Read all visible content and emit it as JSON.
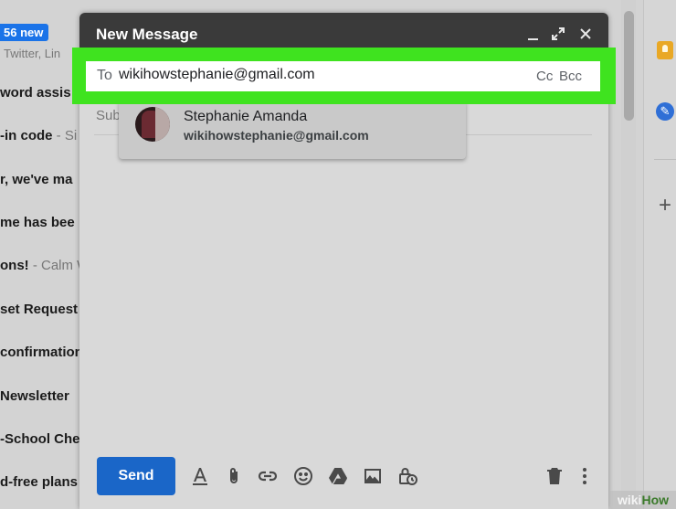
{
  "inbox": {
    "new_badge": "56 new",
    "badge_sub": "Twitter, Lin",
    "rows": [
      {
        "bold": "word assis",
        "snip": ""
      },
      {
        "bold": "-in code",
        "snip": " - Si"
      },
      {
        "bold": "r, we've ma",
        "snip": ""
      },
      {
        "bold": "me has bee",
        "snip": ""
      },
      {
        "bold": "ons!",
        "snip": " - Calm W"
      },
      {
        "bold": "set Request",
        "snip": ""
      },
      {
        "bold": "confirmation",
        "snip": ""
      },
      {
        "bold": " Newsletter",
        "snip": ""
      },
      {
        "bold": "-School Che",
        "snip": ""
      },
      {
        "bold": "d-free plans",
        "snip": ""
      }
    ]
  },
  "compose": {
    "title": "New Message",
    "to_label": "To",
    "to_value": "wikihowstephanie@gmail.com",
    "cc_label": "Cc",
    "bcc_label": "Bcc",
    "subject_label": "Sub",
    "send_label": "Send"
  },
  "suggestion": {
    "name": "Stephanie Amanda",
    "email": "wikihowstephanie@gmail.com"
  },
  "side_panel": {
    "plus": "+",
    "tasks_glyph": "✎"
  },
  "watermark": {
    "wiki": "wiki",
    "how": "How"
  },
  "colors": {
    "highlight": "#3fe31f",
    "send": "#1a66c8",
    "header": "#3a3a3a"
  }
}
